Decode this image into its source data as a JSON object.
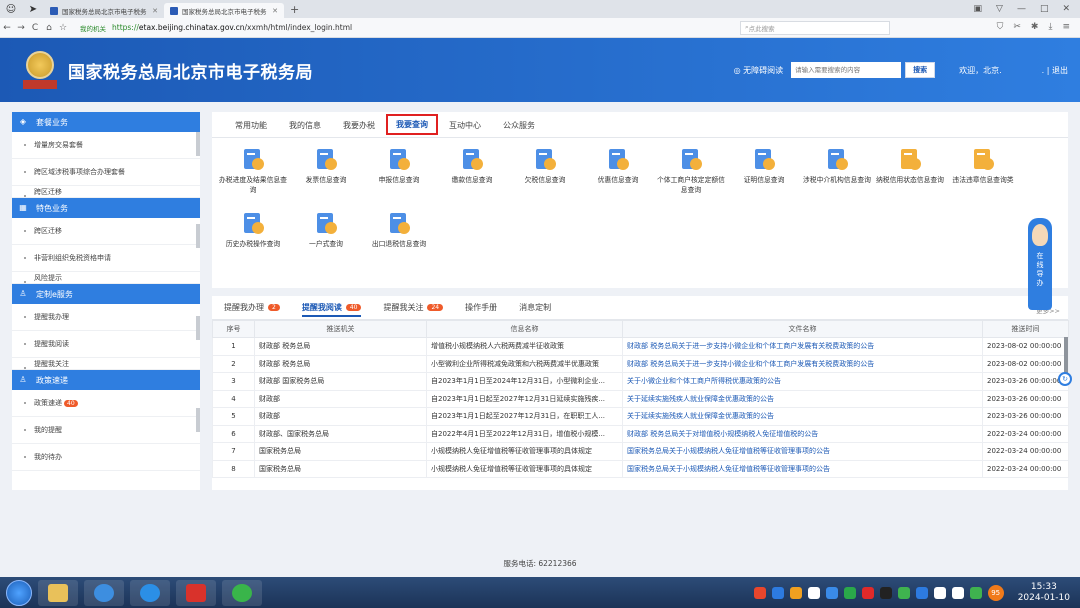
{
  "browser": {
    "tabs": [
      {
        "title": "国家税务总局北京市电子税务"
      },
      {
        "title": "国家税务总局北京市电子税务"
      }
    ],
    "security_label": "我的机关",
    "url_prefix": "https://",
    "url_domain": "etax.beijing.chinatax.gov.cn",
    "url_path": "/xxmh/html/index_login.html",
    "search_placeholder": "点此搜索"
  },
  "header": {
    "site_title": "国家税务总局北京市电子税务局",
    "accessibility": "无障碍阅读",
    "search_placeholder": "请输入需要搜索的内容",
    "search_button": "搜索",
    "welcome": "欢迎，北京.",
    "logout": ". | 退出"
  },
  "sidebar": {
    "groups": [
      {
        "title": "套餐业务",
        "items": [
          "增量房交易套餐",
          "跨区域涉税事项综合办理套餐",
          "跨区迁移"
        ]
      },
      {
        "title": "特色业务",
        "items": [
          "跨区迁移",
          "非营利组织免税资格申请",
          "风险提示"
        ]
      },
      {
        "title": "定制e服务",
        "items": [
          "提醒我办理",
          "提醒我阅读",
          "提醒我关注"
        ]
      },
      {
        "title": "政策速递",
        "items": [
          "政策速递",
          "我的提醒",
          "我的待办"
        ],
        "badge": "40"
      }
    ]
  },
  "main": {
    "tabs": [
      "常用功能",
      "我的信息",
      "我要办税",
      "我要查询",
      "互动中心",
      "公众服务"
    ],
    "functions": [
      {
        "label": "办税进度及结果信息查询"
      },
      {
        "label": "发票信息查询"
      },
      {
        "label": "申报信息查询"
      },
      {
        "label": "缴款信息查询"
      },
      {
        "label": "欠税信息查询"
      },
      {
        "label": "优惠信息查询"
      },
      {
        "label": "个体工商户核定定额信息查询"
      },
      {
        "label": "证明信息查询"
      },
      {
        "label": "涉税中介机构信息查询"
      },
      {
        "label": "纳税信用状态信息查询"
      },
      {
        "label": "违法违章信息查询类"
      },
      {
        "label": "历史办税操作查询"
      },
      {
        "label": "一户式查询"
      },
      {
        "label": "出口退税信息查询"
      }
    ],
    "side_tool": "在线导办"
  },
  "reminders": {
    "tabs": [
      {
        "label": "提醒我办理",
        "badge": "2"
      },
      {
        "label": "提醒我阅读",
        "badge": "40"
      },
      {
        "label": "提醒我关注",
        "badge": "24"
      },
      {
        "label": "操作手册",
        "badge": ""
      },
      {
        "label": "消息定制",
        "badge": ""
      }
    ],
    "more": "更多>>",
    "columns": [
      "序号",
      "推送机关",
      "信息名称",
      "文件名称",
      "推送时间"
    ],
    "rows": [
      [
        "1",
        "财政部 税务总局",
        "增值税小规模纳税人六税两费减半征收政策",
        "财政部 税务总局关于进一步支持小微企业和个体工商户发展有关税费政策的公告",
        "2023-08-02 00:00:00"
      ],
      [
        "2",
        "财政部 税务总局",
        "小型微利企业所得税减免政策和六税两费减半优惠政策",
        "财政部 税务总局关于进一步支持小微企业和个体工商户发展有关税费政策的公告",
        "2023-08-02 00:00:00"
      ],
      [
        "3",
        "财政部 国家税务总局",
        "自2023年1月1日至2024年12月31日，小型微利企业...",
        "关于小微企业和个体工商户所得税优惠政策的公告",
        "2023-03-26 00:00:00"
      ],
      [
        "4",
        "财政部",
        "自2023年1月1日起至2027年12月31日延续实施残疾...",
        "关于延续实施残疾人就业保障金优惠政策的公告",
        "2023-03-26 00:00:00"
      ],
      [
        "5",
        "财政部",
        "自2023年1月1日起至2027年12月31日，在职职工人...",
        "关于延续实施残疾人就业保障金优惠政策的公告",
        "2023-03-26 00:00:00"
      ],
      [
        "6",
        "财政部、国家税务总局",
        "自2022年4月1日至2022年12月31日，增值税小规模...",
        "财政部 税务总局关于对增值税小规模纳税人免征增值税的公告",
        "2022-03-24 00:00:00"
      ],
      [
        "7",
        "国家税务总局",
        "小规模纳税人免征增值税等征收管理事项的具体规定",
        "国家税务总局关于小规模纳税人免征增值税等征收管理事项的公告",
        "2022-03-24 00:00:00"
      ],
      [
        "8",
        "国家税务总局",
        "小规模纳税人免征增值税等征收管理事项的具体规定",
        "国家税务总局关于小规模纳税人免征增值税等征收管理事项的公告",
        "2022-03-24 00:00:00"
      ]
    ]
  },
  "footer": "服务电话: 62212366",
  "taskbar": {
    "time": "15:33",
    "date": "2024-01-10",
    "tray_badge": "95"
  }
}
